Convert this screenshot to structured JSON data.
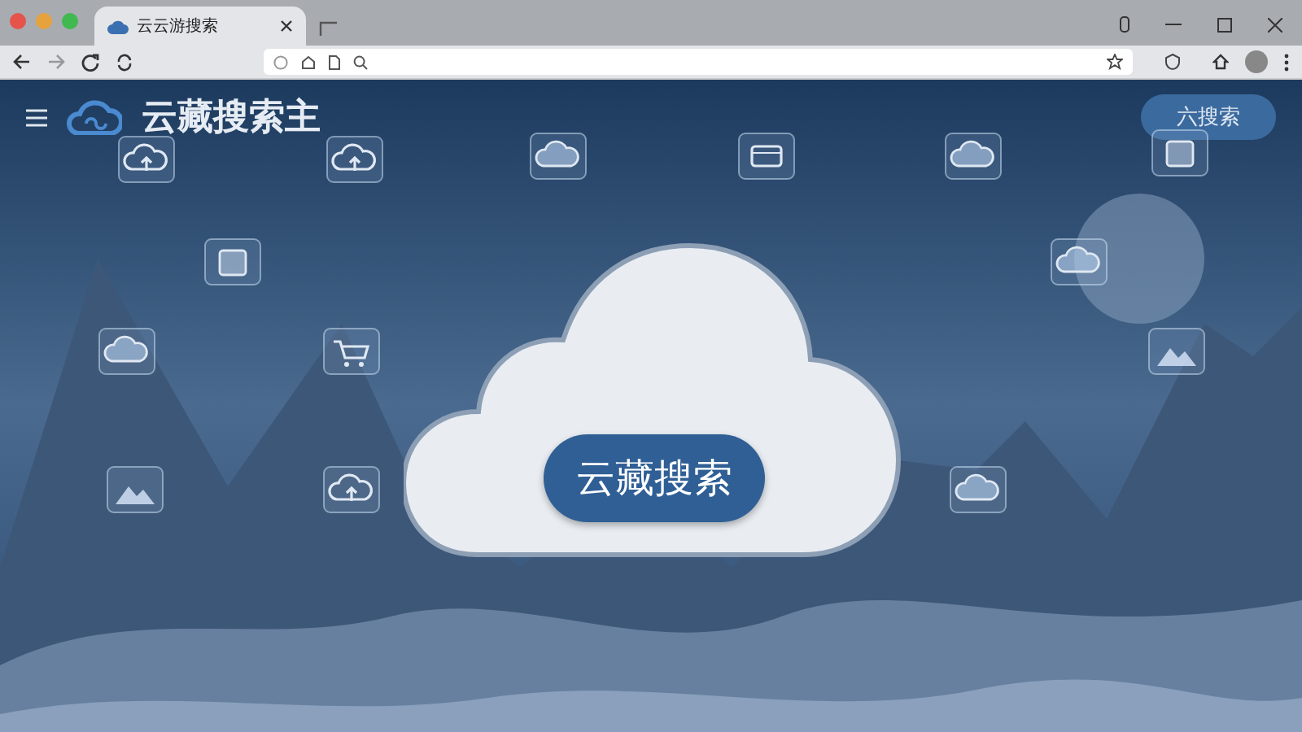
{
  "browser": {
    "tab": {
      "title": "云云游搜索",
      "selected": true
    }
  },
  "header": {
    "site_title": "云藏搜索主",
    "search_button": "六搜索"
  },
  "hero": {
    "button": "云藏搜索"
  }
}
